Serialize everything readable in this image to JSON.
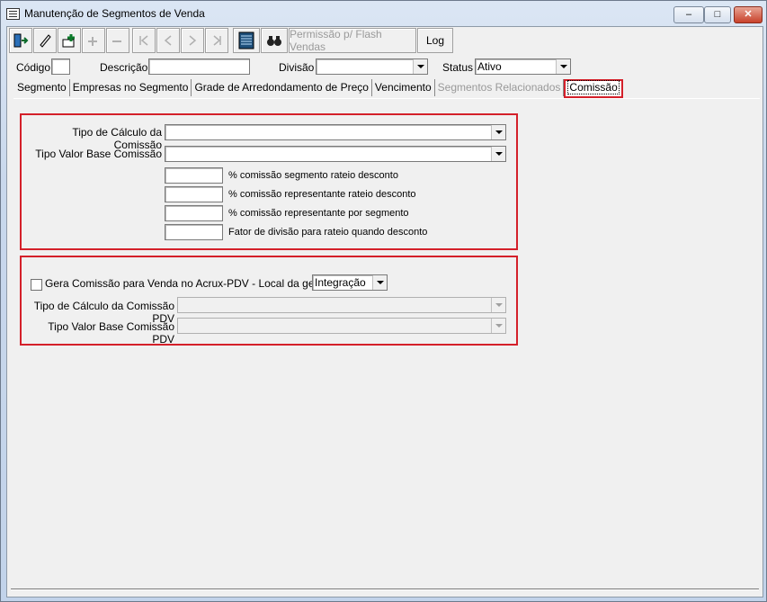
{
  "window": {
    "title": "Manutenção de Segmentos de Venda"
  },
  "titlebar_buttons": {
    "minimize": "–",
    "maximize": "□",
    "close": "✕"
  },
  "toolbar": {
    "permissao_label": "Permissão p/ Flash Vendas",
    "log_label": "Log"
  },
  "filters": {
    "codigo_label": "Código",
    "codigo_value": "",
    "descricao_label": "Descrição",
    "descricao_value": "",
    "divisao_label": "Divisão",
    "divisao_value": "",
    "status_label": "Status",
    "status_value": "Ativo"
  },
  "tabs": [
    {
      "label": "Segmento"
    },
    {
      "label": "Empresas no Segmento"
    },
    {
      "label": "Grade de Arredondamento de Preço"
    },
    {
      "label": "Vencimento"
    },
    {
      "label": "Segmentos Relacionados"
    },
    {
      "label": "Comissão"
    }
  ],
  "commission": {
    "tipo_calculo_label": "Tipo de Cálculo da Comissão",
    "tipo_calculo_value": "",
    "tipo_valor_base_label": "Tipo Valor Base Comissão",
    "tipo_valor_base_value": "",
    "pct_segmento_rateio_label": "% comissão segmento rateio desconto",
    "pct_representante_rateio_label": "% comissão representante rateio desconto",
    "pct_representante_segmento_label": "% comissão representante por segmento",
    "fator_divisao_label": "Fator de divisão para rateio quando desconto"
  },
  "pdv": {
    "gera_comissao_label": "Gera Comissão para Venda no Acrux-PDV - Local da geração",
    "gera_comissao_checked": false,
    "local_geracao_value": "Integração",
    "tipo_calculo_pdv_label": "Tipo de Cálculo da Comissão PDV",
    "tipo_valor_base_pdv_label": "Tipo Valor Base Comissão PDV"
  }
}
